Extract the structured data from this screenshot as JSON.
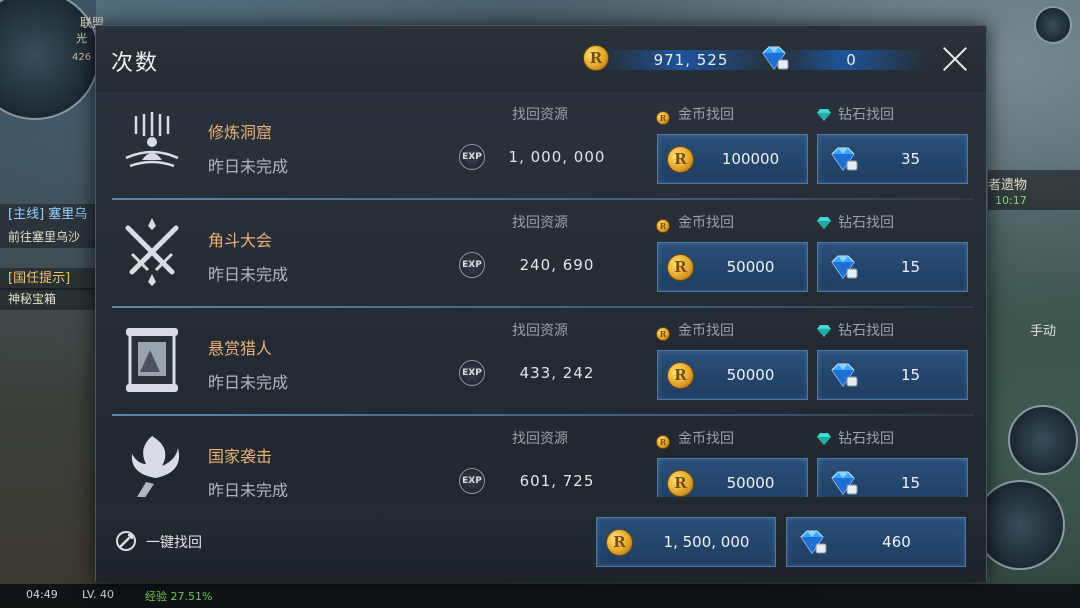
{
  "background": {
    "union_label": "联盟",
    "light_label": "光",
    "num_label": "426",
    "quests": [
      "[主线] 塞里乌",
      "前往塞里乌沙",
      "[国任提示]",
      "神秘宝箱"
    ],
    "right_title": "者遗物",
    "right_time": "10:17",
    "manual_label": "手动",
    "status": {
      "time": "04:49",
      "level": "LV. 40",
      "exp": "经验 27.51%"
    }
  },
  "dialog": {
    "title": "次数",
    "gold_balance": "971, 525",
    "gem_balance": "0",
    "close_icon": "close-icon"
  },
  "rows": [
    {
      "name": "修炼洞窟",
      "status": "昨日未完成",
      "res_label": "找回资源",
      "exp": "1, 000, 000",
      "gold_label": "金币找回",
      "gem_label": "钻石找回",
      "gold_cost": "100000",
      "gem_cost": "35",
      "icon": "meditation-icon"
    },
    {
      "name": "角斗大会",
      "status": "昨日未完成",
      "res_label": "找回资源",
      "exp": "240, 690",
      "gold_label": "金币找回",
      "gem_label": "钻石找回",
      "gold_cost": "50000",
      "gem_cost": "15",
      "icon": "crossed-swords-icon"
    },
    {
      "name": "悬赏猎人",
      "status": "昨日未完成",
      "res_label": "找回资源",
      "exp": "433, 242",
      "gold_label": "金币找回",
      "gem_label": "钻石找回",
      "gold_cost": "50000",
      "gem_cost": "15",
      "icon": "bounty-scroll-icon"
    },
    {
      "name": "国家袭击",
      "status": "昨日未完成",
      "res_label": "找回资源",
      "exp": "601, 725",
      "gold_label": "金币找回",
      "gem_label": "钻石找回",
      "gold_cost": "50000",
      "gem_cost": "15",
      "icon": "flaming-torch-icon"
    }
  ],
  "exp_icon_text": "EXP",
  "coin_symbol": "R",
  "footer": {
    "oneclick_label": "一键找回",
    "total_gold": "1, 500, 000",
    "total_gem": "460"
  },
  "colors": {
    "accent_blue": "#294f78",
    "gold": "#e3a62a",
    "name_orange": "#e8b07a"
  }
}
